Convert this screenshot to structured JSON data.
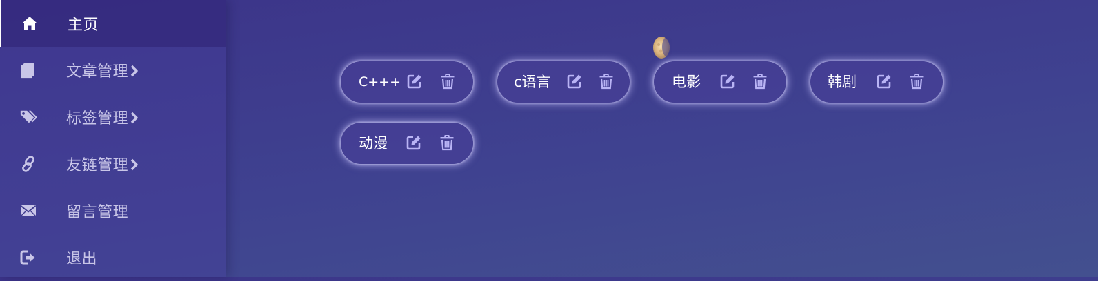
{
  "sidebar": {
    "items": [
      {
        "label": "主页",
        "icon": "home-icon",
        "active": true,
        "has_submenu": false
      },
      {
        "label": "文章管理",
        "icon": "book-icon",
        "active": false,
        "has_submenu": true
      },
      {
        "label": "标签管理",
        "icon": "tags-icon",
        "active": false,
        "has_submenu": true
      },
      {
        "label": "友链管理",
        "icon": "link-icon",
        "active": false,
        "has_submenu": true
      },
      {
        "label": "留言管理",
        "icon": "envelope-icon",
        "active": false,
        "has_submenu": false
      },
      {
        "label": "退出",
        "icon": "logout-icon",
        "active": false,
        "has_submenu": false
      }
    ]
  },
  "tags": [
    {
      "name": "C+++"
    },
    {
      "name": "c语言"
    },
    {
      "name": "电影"
    },
    {
      "name": "韩剧"
    },
    {
      "name": "动漫"
    }
  ],
  "colors": {
    "background_top": "#3c3489",
    "background_bottom": "#43508f",
    "chip_fill": "#463e96",
    "chip_glow": "#c8c3ff",
    "action_icon": "#b9b4f5",
    "sidebar_icon": "#c9c6e8"
  }
}
